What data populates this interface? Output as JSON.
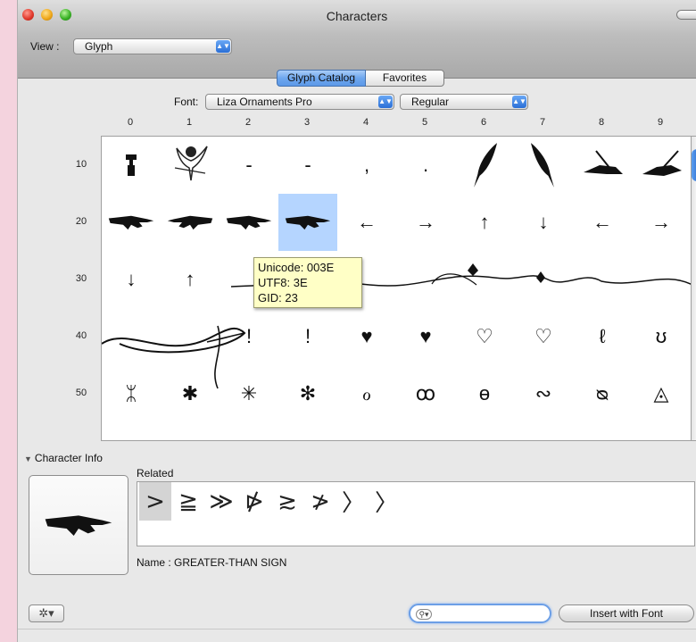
{
  "window": {
    "title": "Characters"
  },
  "toolbar": {
    "view_label": "View :",
    "view_value": "Glyph"
  },
  "tabs": [
    {
      "label": "Glyph Catalog",
      "active": true
    },
    {
      "label": "Favorites",
      "active": false
    }
  ],
  "font": {
    "label": "Font:",
    "family": "Liza Ornaments Pro",
    "style": "Regular"
  },
  "grid": {
    "columns": [
      "0",
      "1",
      "2",
      "3",
      "4",
      "5",
      "6",
      "7",
      "8",
      "9"
    ],
    "rows": [
      "10",
      "20",
      "30",
      "40",
      "50"
    ],
    "text_glyphs": {
      "12": "-",
      "13": "-",
      "14": ",",
      "15": ".",
      "24": "←",
      "25": "→",
      "26": "↑",
      "27": "↓",
      "28": "←",
      "29": "→",
      "30": "↓",
      "31": "↑",
      "42": "!",
      "43": "!",
      "44": "♥",
      "45": "♥",
      "46": "♡",
      "47": "♡",
      "48": "ℓ",
      "49": "ʊ",
      "50": "ᛯ",
      "51": "✱",
      "52": "✳",
      "53": "✻",
      "54": "ℴ",
      "55": "ꝏ",
      "56": "ɵ",
      "57": "∾",
      "58": "ᴓ",
      "59": "◬"
    },
    "selected_index": "23"
  },
  "tooltip": {
    "unicode": "Unicode: 003E",
    "utf8": "UTF8: 3E",
    "gid": "GID: 23"
  },
  "character_info": {
    "header": "Character Info",
    "related_label": "Related",
    "related": [
      ">",
      "≧",
      "≫",
      "⋫",
      "≳",
      "≯",
      "〉",
      "〉"
    ],
    "name": "Name :  GREATER-THAN SIGN"
  },
  "footer": {
    "gear_label": "✲▾",
    "search_value": "",
    "insert_button": "Insert with Font"
  },
  "colors": {
    "selection": "#b5d5ff",
    "accent": "#2d6fd0",
    "tooltip_bg": "#ffffc6"
  }
}
